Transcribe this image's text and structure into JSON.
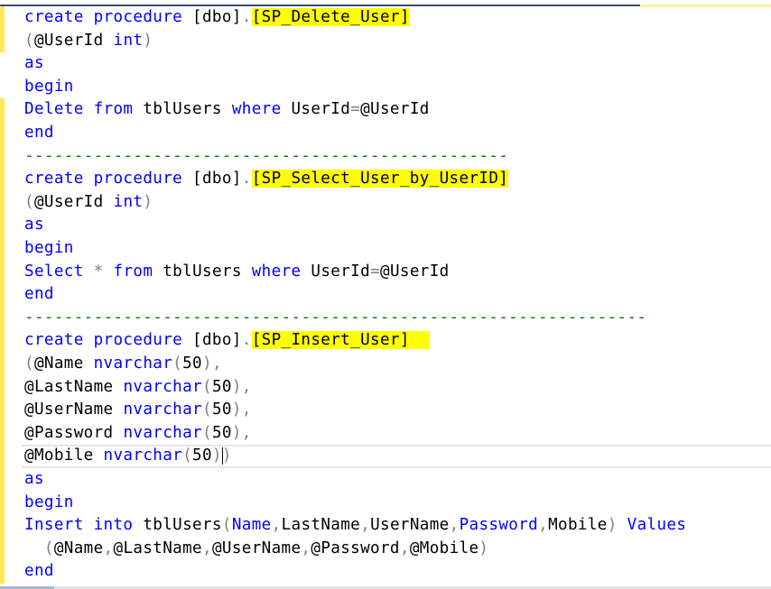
{
  "editor": {
    "lines": [
      {
        "tokens": [
          {
            "t": "create",
            "c": "kw"
          },
          {
            "t": " ",
            "c": "id"
          },
          {
            "t": "procedure",
            "c": "kw"
          },
          {
            "t": " [dbo]",
            "c": "id"
          },
          {
            "t": ".",
            "c": "op"
          },
          {
            "t": "[SP_Delete_User]",
            "c": "id",
            "hl": true
          }
        ]
      },
      {
        "tokens": [
          {
            "t": "(",
            "c": "op"
          },
          {
            "t": "@UserId ",
            "c": "id"
          },
          {
            "t": "int",
            "c": "kw"
          },
          {
            "t": ")",
            "c": "op"
          }
        ]
      },
      {
        "tokens": [
          {
            "t": "as",
            "c": "kw"
          }
        ]
      },
      {
        "tokens": [
          {
            "t": "begin",
            "c": "kw"
          }
        ]
      },
      {
        "tokens": [
          {
            "t": "Delete",
            "c": "kw"
          },
          {
            "t": " ",
            "c": "id"
          },
          {
            "t": "from",
            "c": "kw"
          },
          {
            "t": " tblUsers ",
            "c": "id"
          },
          {
            "t": "where",
            "c": "kw"
          },
          {
            "t": " UserId",
            "c": "id"
          },
          {
            "t": "=",
            "c": "op"
          },
          {
            "t": "@UserId",
            "c": "id"
          }
        ]
      },
      {
        "tokens": [
          {
            "t": "end",
            "c": "kw"
          }
        ]
      },
      {
        "tokens": [
          {
            "t": "-------------------------------------------------",
            "c": "cm"
          }
        ]
      },
      {
        "tokens": [
          {
            "t": "create",
            "c": "kw"
          },
          {
            "t": " ",
            "c": "id"
          },
          {
            "t": "procedure",
            "c": "kw"
          },
          {
            "t": " [dbo]",
            "c": "id"
          },
          {
            "t": ".",
            "c": "op"
          },
          {
            "t": "[SP_Select_User_by_UserID]",
            "c": "id",
            "hl": true
          }
        ]
      },
      {
        "tokens": [
          {
            "t": "(",
            "c": "op"
          },
          {
            "t": "@UserId ",
            "c": "id"
          },
          {
            "t": "int",
            "c": "kw"
          },
          {
            "t": ")",
            "c": "op"
          }
        ]
      },
      {
        "tokens": [
          {
            "t": "as",
            "c": "kw"
          }
        ]
      },
      {
        "tokens": [
          {
            "t": "begin",
            "c": "kw"
          }
        ]
      },
      {
        "tokens": [
          {
            "t": "Select",
            "c": "kw"
          },
          {
            "t": " ",
            "c": "id"
          },
          {
            "t": "*",
            "c": "op"
          },
          {
            "t": " ",
            "c": "id"
          },
          {
            "t": "from",
            "c": "kw"
          },
          {
            "t": " tblUsers ",
            "c": "id"
          },
          {
            "t": "where",
            "c": "kw"
          },
          {
            "t": " UserId",
            "c": "id"
          },
          {
            "t": "=",
            "c": "op"
          },
          {
            "t": "@UserId",
            "c": "id"
          }
        ]
      },
      {
        "tokens": [
          {
            "t": "end",
            "c": "kw"
          }
        ]
      },
      {
        "tokens": [
          {
            "t": "---------------------------------------------------------------",
            "c": "cm"
          }
        ]
      },
      {
        "tokens": [
          {
            "t": "create",
            "c": "kw"
          },
          {
            "t": " ",
            "c": "id"
          },
          {
            "t": "procedure",
            "c": "kw"
          },
          {
            "t": " [dbo]",
            "c": "id"
          },
          {
            "t": ".",
            "c": "op"
          },
          {
            "t": "[SP_Insert_User]  ",
            "c": "id",
            "hl": true
          }
        ]
      },
      {
        "tokens": [
          {
            "t": "(",
            "c": "op"
          },
          {
            "t": "@Name ",
            "c": "id"
          },
          {
            "t": "nvarchar",
            "c": "kw"
          },
          {
            "t": "(",
            "c": "op"
          },
          {
            "t": "50",
            "c": "id"
          },
          {
            "t": "),",
            "c": "op"
          }
        ]
      },
      {
        "tokens": [
          {
            "t": "@LastName ",
            "c": "id"
          },
          {
            "t": "nvarchar",
            "c": "kw"
          },
          {
            "t": "(",
            "c": "op"
          },
          {
            "t": "50",
            "c": "id"
          },
          {
            "t": "),",
            "c": "op"
          }
        ]
      },
      {
        "tokens": [
          {
            "t": "@UserName ",
            "c": "id"
          },
          {
            "t": "nvarchar",
            "c": "kw"
          },
          {
            "t": "(",
            "c": "op"
          },
          {
            "t": "50",
            "c": "id"
          },
          {
            "t": "),",
            "c": "op"
          }
        ]
      },
      {
        "tokens": [
          {
            "t": "@Password ",
            "c": "id"
          },
          {
            "t": "nvarchar",
            "c": "kw"
          },
          {
            "t": "(",
            "c": "op"
          },
          {
            "t": "50",
            "c": "id"
          },
          {
            "t": "),",
            "c": "op"
          }
        ]
      },
      {
        "current": true,
        "tokens": [
          {
            "t": "@Mobile ",
            "c": "id"
          },
          {
            "t": "nvarchar",
            "c": "kw"
          },
          {
            "t": "(",
            "c": "op"
          },
          {
            "t": "50",
            "c": "id"
          },
          {
            "t": ")",
            "c": "op"
          },
          {
            "caret": true
          },
          {
            "t": ")",
            "c": "op"
          }
        ]
      },
      {
        "tokens": [
          {
            "t": "as",
            "c": "kw"
          }
        ]
      },
      {
        "tokens": [
          {
            "t": "begin",
            "c": "kw"
          }
        ]
      },
      {
        "tokens": [
          {
            "t": "Insert",
            "c": "kw"
          },
          {
            "t": " ",
            "c": "id"
          },
          {
            "t": "into",
            "c": "kw"
          },
          {
            "t": " tblUsers",
            "c": "id"
          },
          {
            "t": "(",
            "c": "op"
          },
          {
            "t": "Name",
            "c": "kw"
          },
          {
            "t": ",",
            "c": "op"
          },
          {
            "t": "LastName",
            "c": "id"
          },
          {
            "t": ",",
            "c": "op"
          },
          {
            "t": "UserName",
            "c": "id"
          },
          {
            "t": ",",
            "c": "op"
          },
          {
            "t": "Password",
            "c": "kw"
          },
          {
            "t": ",",
            "c": "op"
          },
          {
            "t": "Mobile",
            "c": "id"
          },
          {
            "t": ")",
            "c": "op"
          },
          {
            "t": " ",
            "c": "id"
          },
          {
            "t": "Values",
            "c": "kw"
          }
        ]
      },
      {
        "tokens": [
          {
            "t": "  (",
            "c": "op"
          },
          {
            "t": "@Name",
            "c": "id"
          },
          {
            "t": ",",
            "c": "op"
          },
          {
            "t": "@LastName",
            "c": "id"
          },
          {
            "t": ",",
            "c": "op"
          },
          {
            "t": "@UserName",
            "c": "id"
          },
          {
            "t": ",",
            "c": "op"
          },
          {
            "t": "@Password",
            "c": "id"
          },
          {
            "t": ",",
            "c": "op"
          },
          {
            "t": "@Mobile",
            "c": "id"
          },
          {
            "t": ")",
            "c": "op"
          }
        ]
      },
      {
        "tokens": [
          {
            "t": "end",
            "c": "kw"
          }
        ]
      }
    ],
    "changed_line_ranges": [
      [
        0,
        1
      ],
      [
        4,
        24
      ]
    ]
  },
  "colors": {
    "keyword": "#0000ff",
    "operator": "#808080",
    "comment": "#008000",
    "identifier": "#000000",
    "highlight": "#ffff00",
    "change_marker": "#ffe957"
  }
}
